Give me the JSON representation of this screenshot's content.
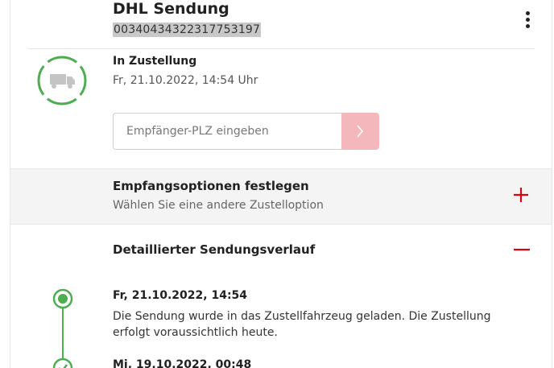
{
  "header": {
    "title": "DHL Sendung",
    "tracking_number": "00340434322317753197",
    "more_icon": "more-vertical-icon"
  },
  "status": {
    "title": "In Zustellung",
    "date": "Fr, 21.10.2022, 14:54 Uhr",
    "icon": "truck-icon",
    "ring_color": "#4cae4f"
  },
  "plz": {
    "placeholder": "Empfänger-PLZ eingeben",
    "value": "",
    "submit_icon": "chevron-right-icon",
    "button_color": "#f4b8bc"
  },
  "options": {
    "title": "Empfangsoptionen festlegen",
    "subtitle": "Wählen Sie eine andere Zustelloption",
    "icon": "plus-icon",
    "accent": "#d40511"
  },
  "history": {
    "title": "Detaillierter Sendungsverlauf",
    "icon": "minus-icon",
    "events": [
      {
        "date": "Fr, 21.10.2022, 14:54",
        "text": "Die Sendung wurde in das Zustellfahrzeug geladen. Die Zustellung erfolgt voraussichtlich heute."
      },
      {
        "date": "Mi, 19.10.2022, 00:48"
      }
    ]
  }
}
